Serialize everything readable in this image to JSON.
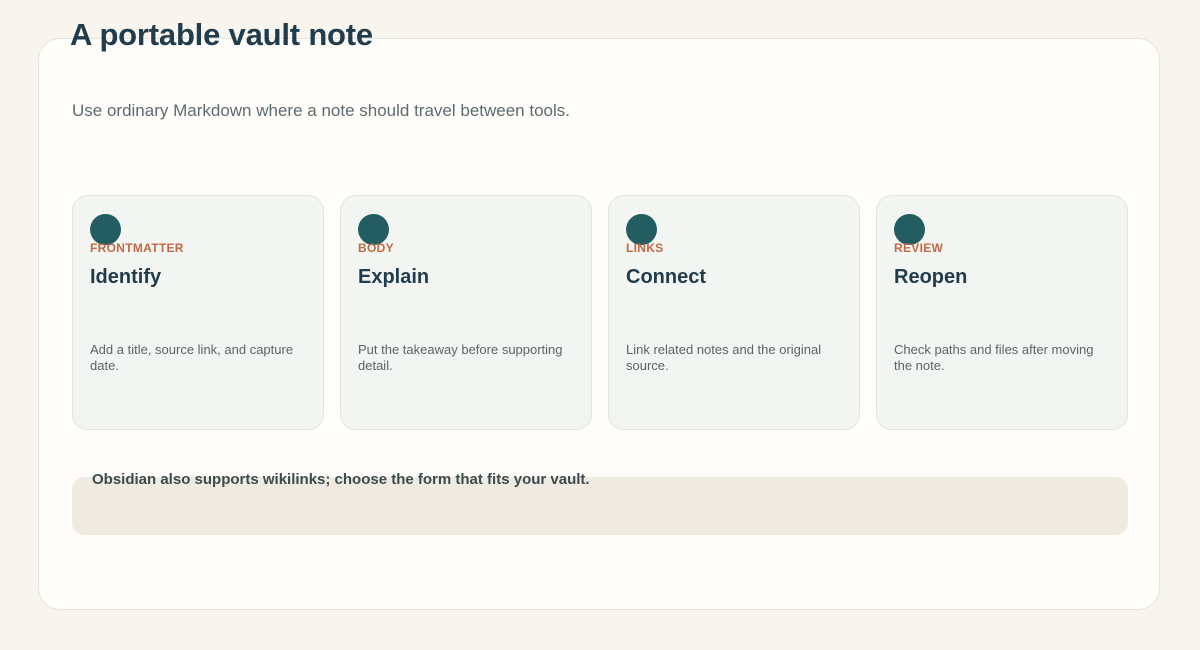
{
  "page": {
    "title": "A portable vault note",
    "subtitle": "Use ordinary Markdown where a note should travel between tools."
  },
  "cards": [
    {
      "eyebrow": "FRONTMATTER",
      "title": "Identify",
      "description": "Add a title, source link, and capture date."
    },
    {
      "eyebrow": "BODY",
      "title": "Explain",
      "description": "Put the takeaway before supporting detail."
    },
    {
      "eyebrow": "LINKS",
      "title": "Connect",
      "description": "Link related notes and the original source."
    },
    {
      "eyebrow": "REVIEW",
      "title": "Reopen",
      "description": "Check paths and files after moving the note."
    }
  ],
  "note": {
    "text": "Obsidian also supports wikilinks; choose the form that fits your vault."
  },
  "colors": {
    "accent_dark": "#235d61",
    "eyebrow": "#c06a45",
    "heading": "#223c4c",
    "card_background": "#f2f5f1",
    "note_background": "#efebe0"
  }
}
